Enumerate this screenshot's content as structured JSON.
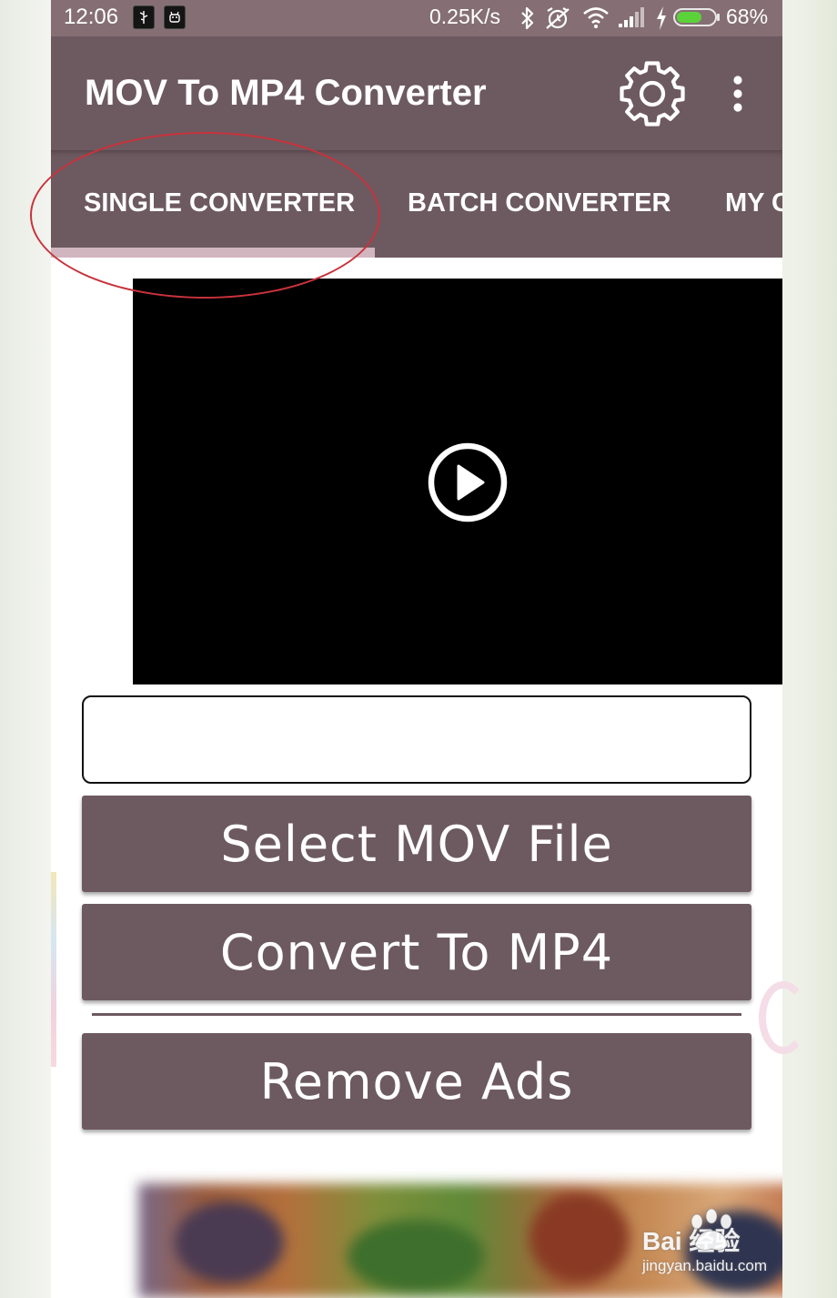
{
  "status_bar": {
    "time": "12:06",
    "network_speed": "0.25K/s",
    "battery_percent": "68%",
    "battery_level": 0.68,
    "icons": [
      "usb-debug-icon",
      "android-icon",
      "bluetooth-icon",
      "alarm-off-icon",
      "wifi-icon",
      "signal-icon",
      "charging-icon",
      "battery-icon"
    ]
  },
  "toolbar": {
    "title": "MOV To MP4 Converter",
    "settings_icon": "gear-icon",
    "menu_icon": "more-vert-icon"
  },
  "tabs": [
    {
      "label": "SINGLE CONVERTER",
      "selected": true
    },
    {
      "label": "BATCH CONVERTER",
      "selected": false
    },
    {
      "label": "MY C",
      "selected": false
    }
  ],
  "player": {
    "play_icon": "play-circle-icon"
  },
  "filename_field": {
    "value": "",
    "placeholder": ""
  },
  "buttons": {
    "select_file": "Select MOV File",
    "convert": "Convert To MP4",
    "remove_ads": "Remove Ads"
  },
  "watermark": {
    "brand": "Bai  经验",
    "url": "jingyan.baidu.com"
  },
  "colors": {
    "primary": "#6d5a60",
    "status_bar": "#856f74",
    "tab_indicator": "#d1b6c0",
    "annotation": "#c8323b",
    "battery_fill": "#5bd23a"
  }
}
